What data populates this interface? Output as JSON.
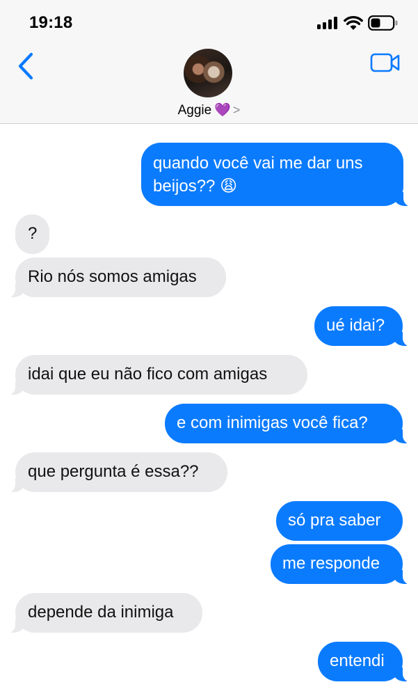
{
  "status_bar": {
    "time": "19:18"
  },
  "header": {
    "contact_name": "Aggie",
    "contact_emoji": "💜",
    "chevron": ">"
  },
  "colors": {
    "sent_bubble": "#0b7bfe",
    "received_bubble": "#e9e9eb",
    "accent": "#0a7aff"
  },
  "messages": [
    {
      "direction": "sent",
      "line1": "quando você vai me dar uns",
      "line2": "beijos?? 😩"
    },
    {
      "direction": "received",
      "text": "?"
    },
    {
      "direction": "received",
      "text": "Rio nós somos amigas"
    },
    {
      "direction": "sent",
      "text": "ué idai?"
    },
    {
      "direction": "received",
      "text": "idai que eu não fico com amigas"
    },
    {
      "direction": "sent",
      "text": "e com inimigas você fica?"
    },
    {
      "direction": "received",
      "text": "que pergunta é essa??"
    },
    {
      "direction": "sent",
      "text": "só pra saber"
    },
    {
      "direction": "sent",
      "text": "me responde"
    },
    {
      "direction": "received",
      "text": "depende da inimiga"
    },
    {
      "direction": "sent",
      "text": "entendi"
    }
  ]
}
